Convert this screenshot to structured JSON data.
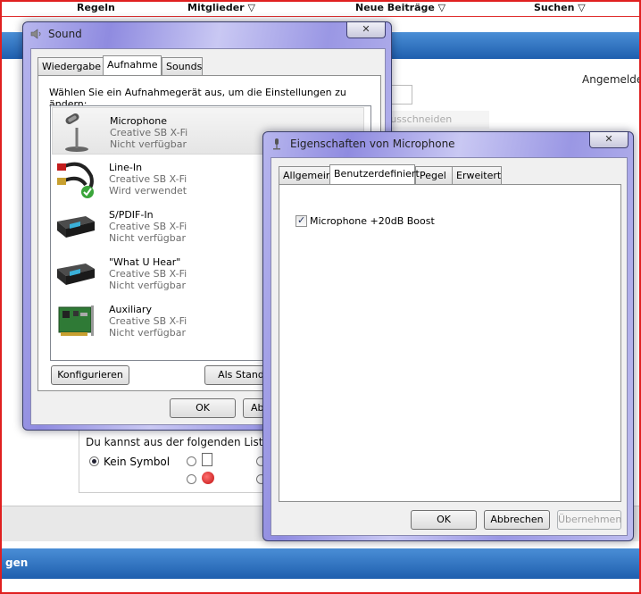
{
  "forum": {
    "nav": [
      "Regeln",
      "Mitglieder ▽",
      "Neue Beiträge ▽",
      "Suchen ▽"
    ],
    "logged_in_text": "Angemelde",
    "faded_button": "Rechteckigen Ausschneiden",
    "icon_list_text": "Du kannst aus der folgenden Liste",
    "no_symbol_label": "Kein Symbol",
    "bottom_bar_text": "gen"
  },
  "sound_dialog": {
    "title": "Sound",
    "tabs": [
      "Wiedergabe",
      "Aufnahme",
      "Sounds"
    ],
    "active_tab": "Aufnahme",
    "instruction": "Wählen Sie ein Aufnahmegerät aus, um die Einstellungen zu ändern:",
    "devices": [
      {
        "name": "Microphone",
        "driver": "Creative SB X-Fi",
        "status": "Nicht verfügbar",
        "icon": "microphone-icon",
        "selected": true
      },
      {
        "name": "Line-In",
        "driver": "Creative SB X-Fi",
        "status": "Wird verwendet",
        "icon": "rca-cable-icon",
        "selected": false
      },
      {
        "name": "S/PDIF-In",
        "driver": "Creative SB X-Fi",
        "status": "Nicht verfügbar",
        "icon": "sound-device-icon",
        "selected": false
      },
      {
        "name": "\"What U Hear\"",
        "driver": "Creative SB X-Fi",
        "status": "Nicht verfügbar",
        "icon": "sound-device-icon",
        "selected": false
      },
      {
        "name": "Auxiliary",
        "driver": "Creative SB X-Fi",
        "status": "Nicht verfügbar",
        "icon": "sound-card-icon",
        "selected": false
      }
    ],
    "configure_label": "Konfigurieren",
    "set_default_label": "Als Standard",
    "ok_label": "OK",
    "cancel_label": "Abb"
  },
  "props_dialog": {
    "title": "Eigenschaften von Microphone",
    "tabs": [
      "Allgemein",
      "Benutzerdefiniert",
      "Pegel",
      "Erweitert"
    ],
    "active_tab": "Benutzerdefiniert",
    "boost_label": "Microphone +20dB Boost",
    "boost_checked": true,
    "ok_label": "OK",
    "cancel_label": "Abbrechen",
    "apply_label": "Übernehmen"
  }
}
